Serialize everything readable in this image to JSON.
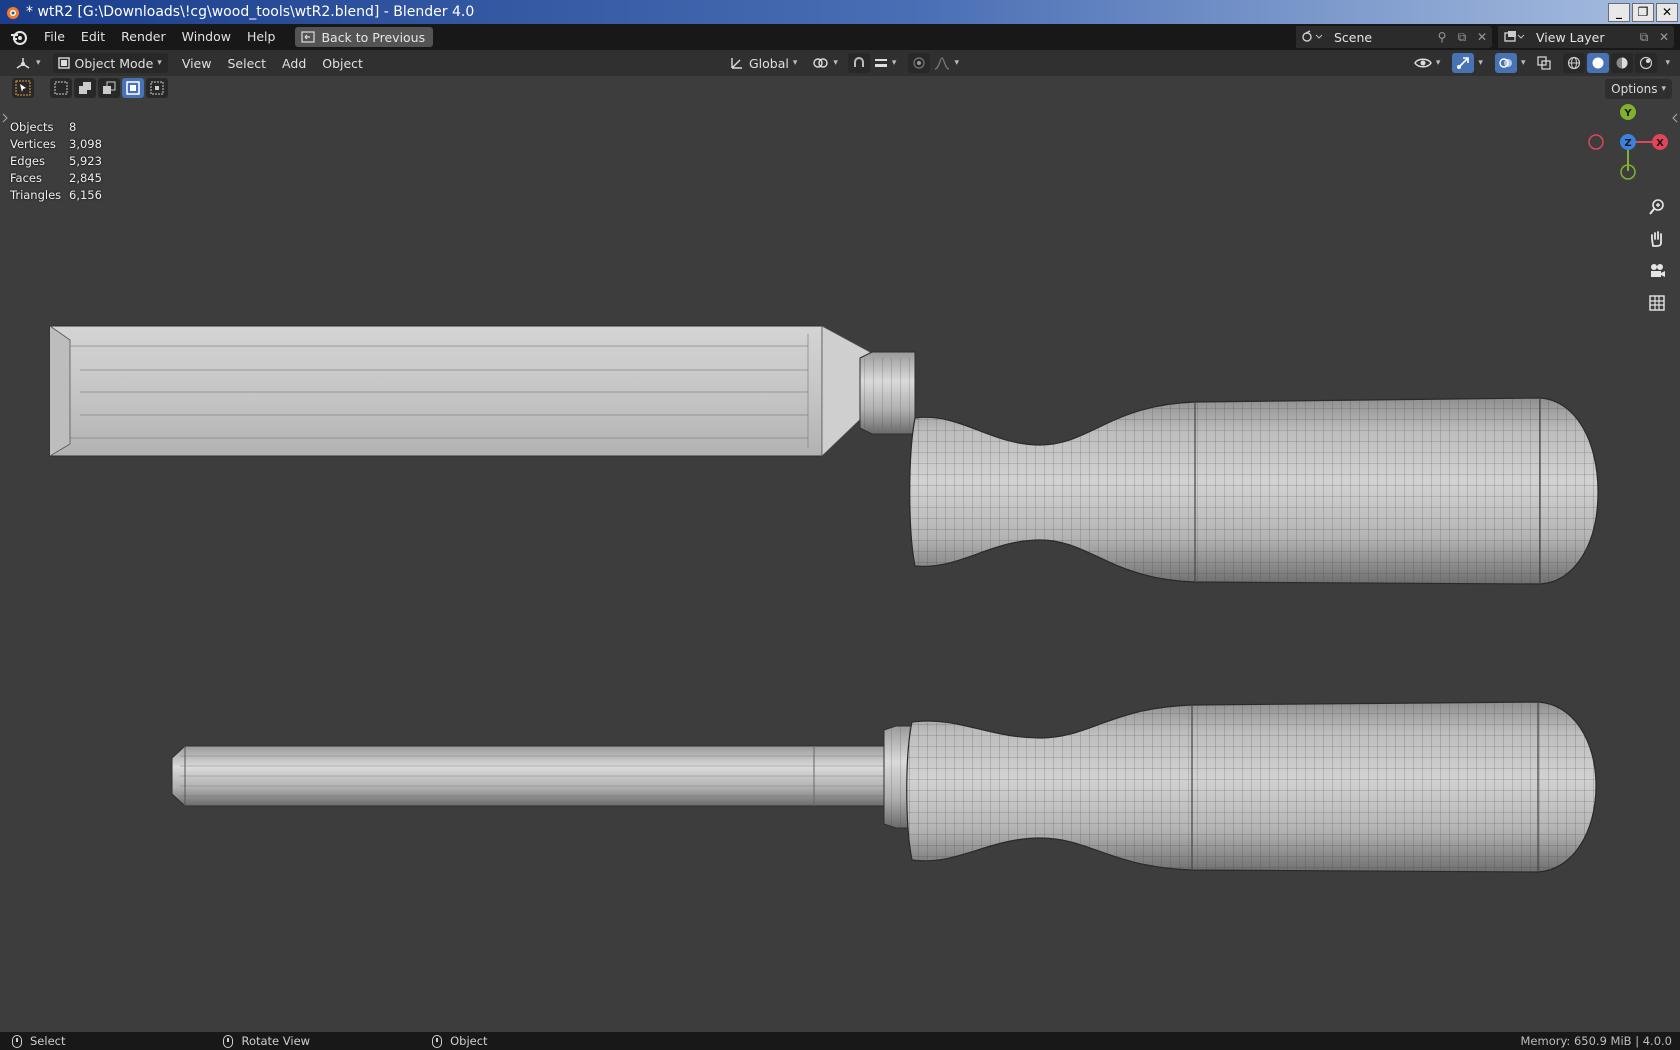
{
  "window": {
    "title": "* wtR2 [G:\\Downloads\\!cg\\wood_tools\\wtR2.blend] - Blender 4.0",
    "controls": [
      "minimize-icon",
      "restore-icon",
      "close-icon"
    ]
  },
  "topbar": {
    "menus": [
      "File",
      "Edit",
      "Render",
      "Window",
      "Help"
    ],
    "back_button": "Back to Previous",
    "scene": "Scene",
    "view_layer": "View Layer"
  },
  "viewport_header": {
    "mode": "Object Mode",
    "menus": [
      "View",
      "Select",
      "Add",
      "Object"
    ],
    "transform_orientation": "Global"
  },
  "tool_settings": {
    "options_label": "Options"
  },
  "statistics": [
    {
      "label": "Objects",
      "value": "8"
    },
    {
      "label": "Vertices",
      "value": "3,098"
    },
    {
      "label": "Edges",
      "value": "5,923"
    },
    {
      "label": "Faces",
      "value": "2,845"
    },
    {
      "label": "Triangles",
      "value": "6,156"
    }
  ],
  "gizmo": {
    "y": "Y",
    "x": "X",
    "z": "Z",
    "colors": {
      "x": "#e0455b",
      "y": "#80b230",
      "z": "#3b82e0"
    }
  },
  "statusbar": {
    "left": "Select",
    "middle": "Rotate View",
    "right": "Object",
    "memory": "Memory: 650.9 MiB | 4.0.0"
  },
  "colors": {
    "viewport_bg": "#3d3d3d",
    "header_bg": "#303030",
    "topbar_bg": "#181818",
    "accent": "#4772b3",
    "mesh": "#b8b8b8",
    "wire": "#2f2f2f"
  }
}
